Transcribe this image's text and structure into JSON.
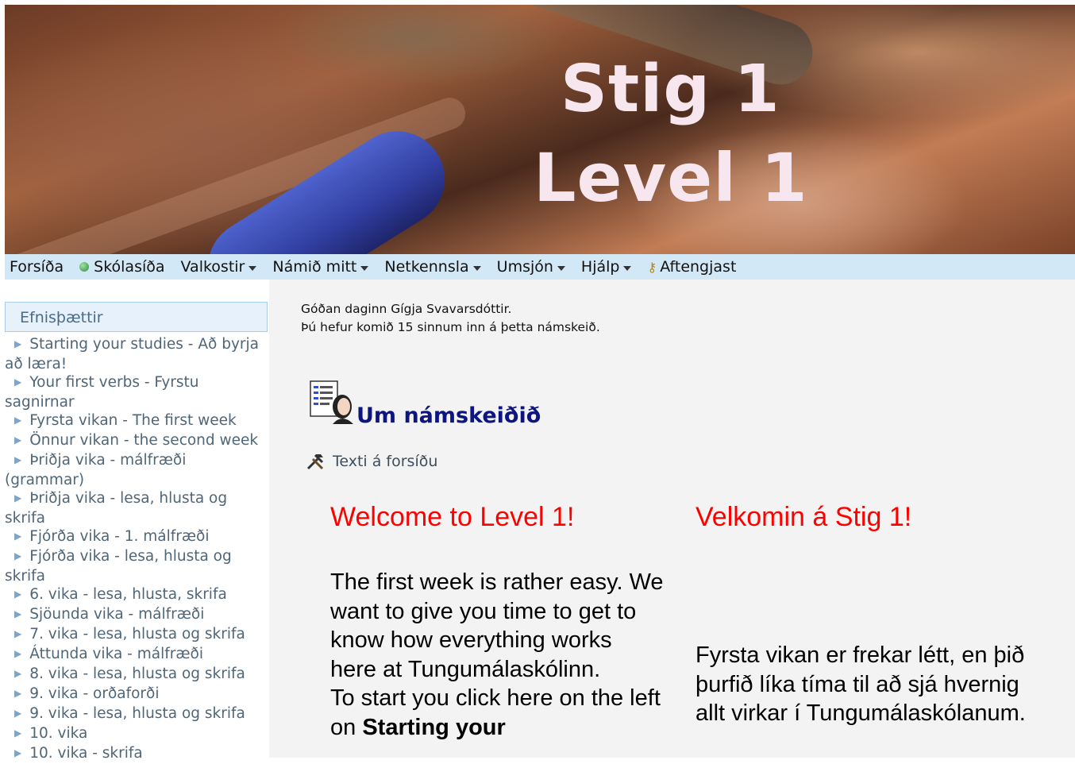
{
  "banner": {
    "line1": "Stig 1",
    "line2": "Level 1"
  },
  "nav": {
    "items": [
      {
        "label": "Forsíða",
        "dropdown": false
      },
      {
        "label": "Skólasíða",
        "dropdown": false,
        "icon": "globe-icon"
      },
      {
        "label": "Valkostir",
        "dropdown": true
      },
      {
        "label": "Námið mitt",
        "dropdown": true
      },
      {
        "label": "Netkennsla",
        "dropdown": true
      },
      {
        "label": "Umsjón",
        "dropdown": true
      },
      {
        "label": "Hjálp",
        "dropdown": true
      },
      {
        "label": "Aftengjast",
        "dropdown": false,
        "icon": "key-icon"
      }
    ]
  },
  "sidebar": {
    "title": "Efnisþættir",
    "topics": [
      "Starting your studies - Að byrja að læra!",
      "Your first verbs - Fyrstu sagnirnar",
      "Fyrsta vikan - The first week",
      "Önnur vikan - the second week",
      "Þriðja vika - málfræði (grammar)",
      "Þriðja vika - lesa, hlusta og skrifa",
      "Fjórða vika - 1. málfræði",
      "Fjórða vika - lesa, hlusta og skrifa",
      "6. vika - lesa, hlusta, skrifa",
      "Sjöunda vika - málfræði",
      "7. vika - lesa, hlusta og skrifa",
      "Áttunda vika - málfræði",
      "8. vika - lesa, hlusta og skrifa",
      "9. vika - orðaforði",
      "9. vika - lesa, hlusta og skrifa",
      "10. vika",
      "10. vika - skrifa"
    ]
  },
  "main": {
    "greeting": "Góðan daginn Gígja Svavarsdóttir.",
    "visits": "Þú hefur komið 15 sinnum inn á þetta námskeið.",
    "course_title": "Um námskeiðið",
    "tools_link": "Texti á forsíðu",
    "left": {
      "heading": "Welcome to Level 1!",
      "p1": "The first week is rather easy. We want to give you time to get to know how everything works here at Tungumálaskólinn.",
      "p2_start": "To start you click here on the left on ",
      "p2_bold": "Starting your"
    },
    "right": {
      "heading": "Velkomin á Stig 1!",
      "p1": "Fyrsta vikan er frekar létt, en þið þurfið líka tíma til að sjá hvernig allt virkar í Tungumálaskólanum."
    }
  },
  "colors": {
    "nav_bg": "#d3e8f6",
    "title_blue": "#0d1580",
    "welcome_red": "#ff0000",
    "main_bg": "#f3f3f3"
  }
}
